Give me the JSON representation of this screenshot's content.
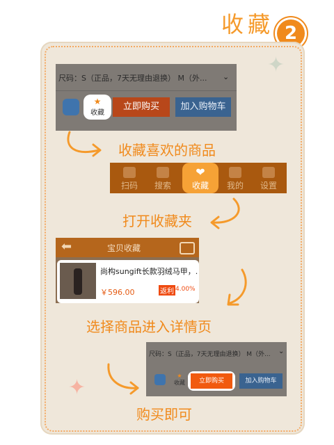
{
  "header": {
    "title": "收藏",
    "step_number": "2"
  },
  "step1": {
    "size_text": "尺码：S（正品，7天无理由退换） M（外...",
    "fav_label": "收藏",
    "buy_now_label": "立即购买",
    "add_cart_label": "加入购物车",
    "caption": "收藏喜欢的商品"
  },
  "step2": {
    "nav_items": [
      {
        "label": "扫码",
        "icon": "scan-icon"
      },
      {
        "label": "搜索",
        "icon": "search-icon"
      },
      {
        "label": "收藏",
        "icon": "heart-icon"
      },
      {
        "label": "我的",
        "icon": "user-icon"
      },
      {
        "label": "设置",
        "icon": "grid-icon"
      }
    ],
    "caption": "打开收藏夹"
  },
  "step3": {
    "header_title": "宝贝收藏",
    "product_name": "尚构sungift长款羽绒马甲，...",
    "price": "￥596.00",
    "rebate_tag": "返利",
    "rebate_pct": "4.00%",
    "caption": "选择商品进入详情页"
  },
  "step4": {
    "size_text": "尺码：S（正品，7天无理由退换） M（外...",
    "fav_label": "收藏",
    "buy_now_label": "立即购买",
    "add_cart_label": "加入购物车",
    "caption": "购买即可"
  },
  "colors": {
    "accent": "#f59a2b",
    "buy_button": "#f15a0f",
    "cart_button": "#3f74ad",
    "nav_bar": "#a9590f"
  }
}
